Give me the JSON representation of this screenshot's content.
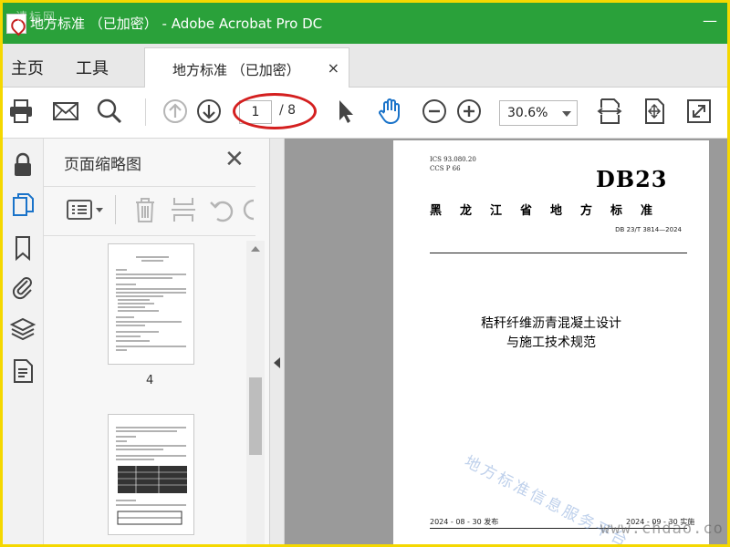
{
  "window": {
    "title": "地方标准 （已加密） - Adobe Acrobat Pro DC",
    "watermark": "请标网",
    "minimize_glyph": "—"
  },
  "nav": {
    "home_label": "主页",
    "tools_label": "工具",
    "tab_label": "地方标准 （已加密）",
    "tab_close": "×"
  },
  "toolbar": {
    "current_page": "1",
    "total_pages": "/ 8",
    "zoom": "30.6%",
    "icons": [
      "print-icon",
      "email-icon",
      "search-icon",
      "page-up-icon",
      "page-down-icon",
      "select-cursor-icon",
      "hand-tool-icon",
      "zoom-out-icon",
      "zoom-in-icon",
      "fit-width-icon",
      "fit-page-icon",
      "full-screen-icon"
    ]
  },
  "rail": {
    "icons": [
      "lock-icon",
      "pages-icon",
      "bookmark-icon",
      "attachment-icon",
      "layers-icon",
      "document-properties-icon"
    ]
  },
  "thumbnails": {
    "title": "页面缩略图",
    "close": "✕",
    "pages": [
      {
        "num": "4"
      },
      {
        "num": ""
      }
    ]
  },
  "document": {
    "ics": "ICS  93.080.20",
    "ccs": "CCS  P 66",
    "standard_code": "DB23",
    "issuer": "黑龙江省地方标准",
    "doc_number": "DB 23/T 3814—2024",
    "title_line1": "秸秆纤维沥青混凝土设计",
    "title_line2": "与施工技术规范",
    "issue_date": "2024 - 08 - 30 发布",
    "impl_date": "2024 - 09 - 30 实施",
    "watermark": "地方标准信息服务平台",
    "site_watermark": "www.chdao.co"
  },
  "colors": {
    "titlebar": "#2aa13a",
    "highlight_ellipse": "#d41f1f",
    "frame_border": "#f5d800",
    "hand_tool": "#1a73c9",
    "pages_icon": "#1a73c9"
  }
}
